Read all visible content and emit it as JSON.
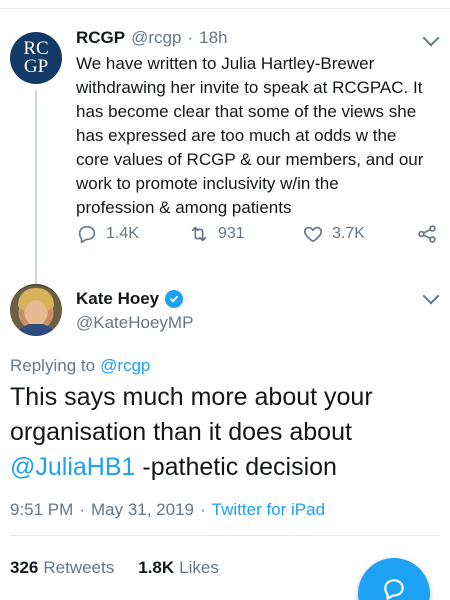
{
  "parent_tweet": {
    "avatar_lines": [
      "RC",
      "GP"
    ],
    "name": "RCGP",
    "handle": "@rcgp",
    "separator": "·",
    "time": "18h",
    "text": "We have written to Julia Hartley-Brewer\nwithdrawing her invite to speak at RCGPAC. It\nhas become clear that some of the views she\nhas expressed are too much at odds w the\ncore values of RCGP & our members, and our\nwork to promote inclusivity w/in the\nprofession & among patients",
    "replies": "1.4K",
    "retweets": "931",
    "likes": "3.7K"
  },
  "main_tweet": {
    "name": "Kate Hoey",
    "handle": "@KateHoeyMP",
    "replying_label": "Replying to",
    "replying_to": "@rcgp",
    "text_before": "This says much more about your organisation than it does about ",
    "mention": "@JuliaHB1",
    "text_after": " -pathetic decision",
    "time": "9:51 PM",
    "meta_sep": "·",
    "date": "May 31, 2019",
    "source": "Twitter for iPad",
    "retweets_count": "326",
    "retweets_label": "Retweets",
    "likes_count": "1.8K",
    "likes_label": "Likes"
  },
  "icons": {
    "reply": "reply-icon",
    "retweet": "retweet-icon",
    "like": "heart-icon",
    "share": "share-icon",
    "verified": "verified-badge-icon",
    "menu": "chevron-down-icon",
    "compose": "compose-fab-icon"
  },
  "colors": {
    "accent": "#1da1f2",
    "secondary_text": "#657786",
    "rcgp_avatar": "#123a66"
  }
}
